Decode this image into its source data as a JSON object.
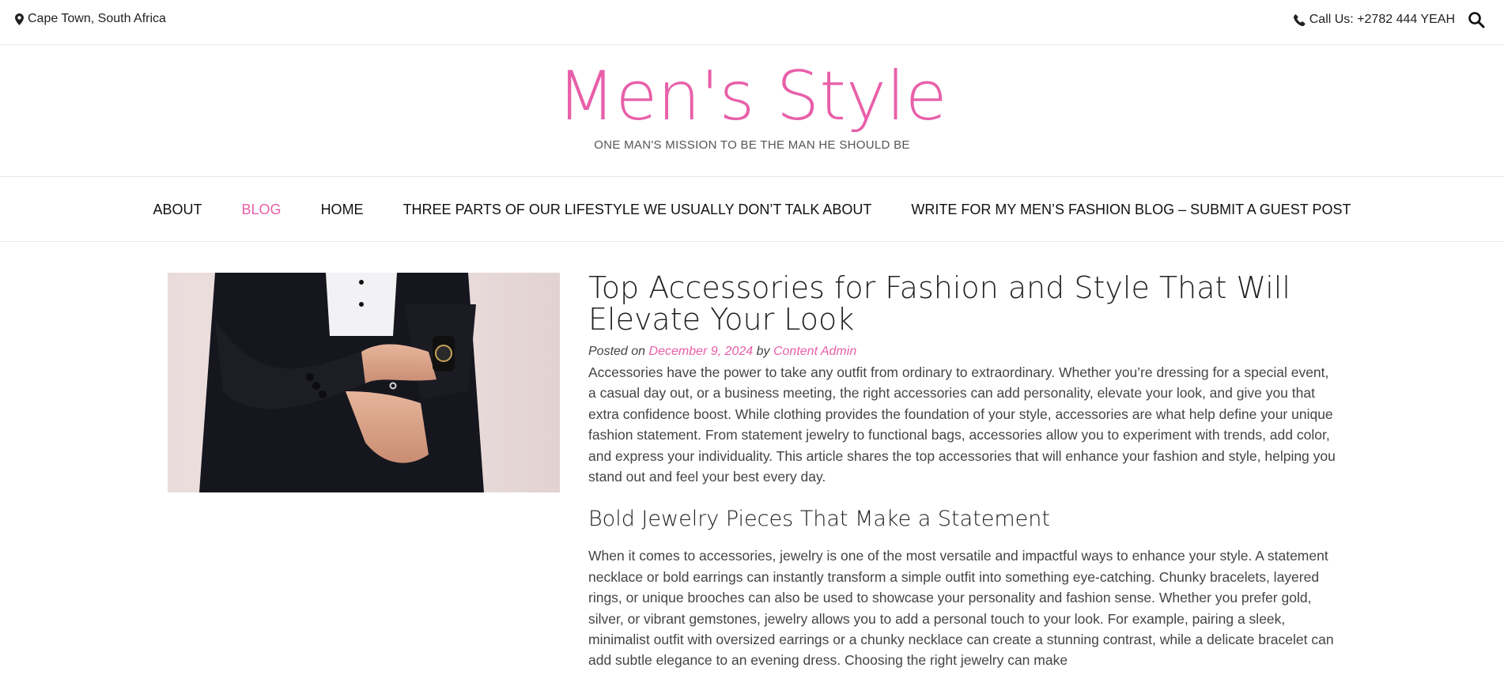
{
  "topbar": {
    "location": "Cape Town, South Africa",
    "phone": "Call Us: +2782 444 YEAH",
    "icons": {
      "location": "map-marker-icon",
      "phone": "phone-icon",
      "search": "search-icon"
    }
  },
  "site": {
    "title": "Men's Style",
    "tagline": "ONE MAN'S MISSION TO BE THE MAN HE SHOULD BE",
    "accent_color": "#e85fa9"
  },
  "nav": {
    "items": [
      {
        "label": "ABOUT",
        "active": false
      },
      {
        "label": "BLOG",
        "active": true
      },
      {
        "label": "HOME",
        "active": false
      },
      {
        "label": "THREE PARTS OF OUR LIFESTYLE WE USUALLY DON’T TALK ABOUT",
        "active": false
      },
      {
        "label": "WRITE FOR MY MEN’S FASHION BLOG – SUBMIT A GUEST POST",
        "active": false
      }
    ]
  },
  "post": {
    "title": "Top Accessories for Fashion and Style That Will Elevate Your Look",
    "meta_prefix": "Posted on",
    "date": "December 9, 2024",
    "meta_by": "by",
    "author": "Content Admin",
    "intro": "Accessories have the power to take any outfit from ordinary to extraordinary. Whether you’re dressing for a special event, a casual day out, or a business meeting, the right accessories can add personality, elevate your look, and give you that extra confidence boost. While clothing provides the foundation of your style, accessories are what help define your unique fashion statement. From statement jewelry to functional bags, accessories allow you to experiment with trends, add color, and express your individuality. This article shares the top accessories that will enhance your fashion and style, helping you stand out and feel your best every day.",
    "section_heading": "Bold Jewelry Pieces That Make a Statement",
    "section_body": "When it comes to accessories, jewelry is one of the most versatile and impactful ways to enhance your style. A statement necklace or bold earrings can instantly transform a simple outfit into something eye-catching. Chunky bracelets, layered rings, or unique brooches can also be used to showcase your personality and fashion sense. Whether you prefer gold, silver, or vibrant gemstones, jewelry allows you to add a personal touch to your look. For example, pairing a sleek, minimalist outfit with oversized earrings or a chunky necklace can create a stunning contrast, while a delicate bracelet can add subtle elegance to an evening dress. Choosing the right jewelry can make"
  }
}
